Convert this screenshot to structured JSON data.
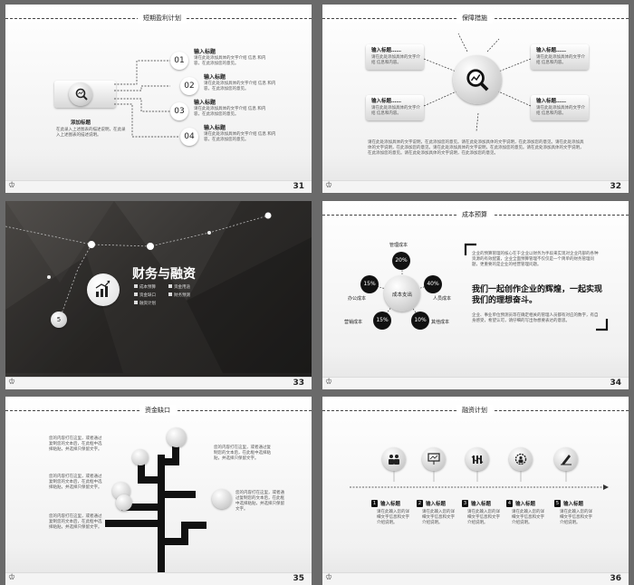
{
  "s31": {
    "title": "短期盈利计划",
    "page": "31",
    "center_title": "添加标题",
    "center_text": "在此录入上述图表的描述说明，在此录入上述图表的描述说明。",
    "items": [
      {
        "num": "01",
        "title": "输入标题",
        "text": "请在此处添加具体的文字介绍 信息 和内容，在此添加您的意见。"
      },
      {
        "num": "02",
        "title": "输入标题",
        "text": "请在此处添加具体的文字介绍 信息 和内容，在此添加您的意见。"
      },
      {
        "num": "03",
        "title": "输入标题",
        "text": "请在此处添加具体的文字介绍 信息 和内容，在此添加您的意见。"
      },
      {
        "num": "04",
        "title": "输入标题",
        "text": "请在此处添加具体的文字介绍 信息 和内容，在此添加您的意见。"
      }
    ]
  },
  "s32": {
    "title": "保障措施",
    "page": "32",
    "items": [
      {
        "title": "输入标题……",
        "text": "请在此处添加具体的文字介绍 信息和内容。"
      },
      {
        "title": "输入标题……",
        "text": "请在此处添加具体的文字介绍 信息和内容。"
      },
      {
        "title": "输入标题……",
        "text": "请在此处添加具体的文字介绍 信息和内容。"
      },
      {
        "title": "输入标题……",
        "text": "请在此处添加具体的文字介绍 信息和内容。"
      }
    ],
    "bottom_text": "请在此处添加具体的文字说明，在此添加您的意见。请在此处添加具体的文字说明，在此添加您的意见。请在此处添加具体的文字说明，在此添加您的意见。请在此处添加具体的文字说明，在此添加您的意见。请在此处添加具体的文字说明，在此添加您的意见。请在此处添加具体的文字说明，在此添加您的意见。"
  },
  "s33": {
    "title": "财务与融资",
    "page": "33",
    "badge": "5",
    "menu": [
      "成本预算",
      "资金缺口",
      "融资计划",
      "资金用途",
      "财务预测"
    ]
  },
  "s34": {
    "title": "成本预算",
    "page": "34",
    "center": "成本支出",
    "nodes": [
      {
        "pct": "20%",
        "label": "管理成本"
      },
      {
        "pct": "40%",
        "label": "人员成本"
      },
      {
        "pct": "10%",
        "label": "其他成本"
      },
      {
        "pct": "15%",
        "label": "营销成本"
      },
      {
        "pct": "15%",
        "label": "办公成本"
      }
    ],
    "para1": "企业的预算管理的核心在于企业以财务为手段来实现对企业内部的各种资源的有效配置，企业全面预算管理不仅仅是一个简单的财务管理问题，更重要的是企业的经营管理问题。",
    "quote": "我们一起创作企业的辉煌，一起实现我们的理想奋斗。",
    "para2": "企业、事业单位预测员等在确定相关的管理人员都有对应的数字，有自身感受，希望认可，请仔细的写出你想要表达的意思。"
  },
  "s35": {
    "title": "资金缺口",
    "page": "35",
    "texts": [
      "您的内容打在这里，或者通过复制您的文本后，在此框中选择粘贴，并选择只保留文字。",
      "您的内容打在这里，或者通过复制您的文本后，在此框中选择粘贴，并选择只保留文字。",
      "您的内容打在这里，或者通过复制您的文本后，在此框中选择粘贴，并选择只保留文字。",
      "您的内容打在这里，或者通过复制您的文本后，在此框中选择粘贴，并选择只保留文字。",
      "您的内容打在这里，或者通过复制您的文本后，在此框中选择粘贴，并选择只保留文字。"
    ]
  },
  "s36": {
    "title": "融资计划",
    "page": "36",
    "steps": [
      {
        "num": "1",
        "title": "输入标题",
        "text": "请在此输入您的详细文字信息和文字介绍说明。",
        "icon": "people-icon"
      },
      {
        "num": "2",
        "title": "输入标题",
        "text": "请在此输入您的详细文字信息和文字介绍说明。",
        "icon": "presentation-icon"
      },
      {
        "num": "3",
        "title": "输入标题",
        "text": "请在此输入您的详细文字信息和文字介绍说明。",
        "icon": "chart-down-icon"
      },
      {
        "num": "4",
        "title": "输入标题",
        "text": "请在此输入您的详细文字信息和文字介绍说明。",
        "icon": "settings-person-icon"
      },
      {
        "num": "5",
        "title": "输入标题",
        "text": "请在此输入您的详细文字信息和文字介绍说明。",
        "icon": "pen-icon"
      }
    ]
  },
  "footer_icon": "crown-icon"
}
